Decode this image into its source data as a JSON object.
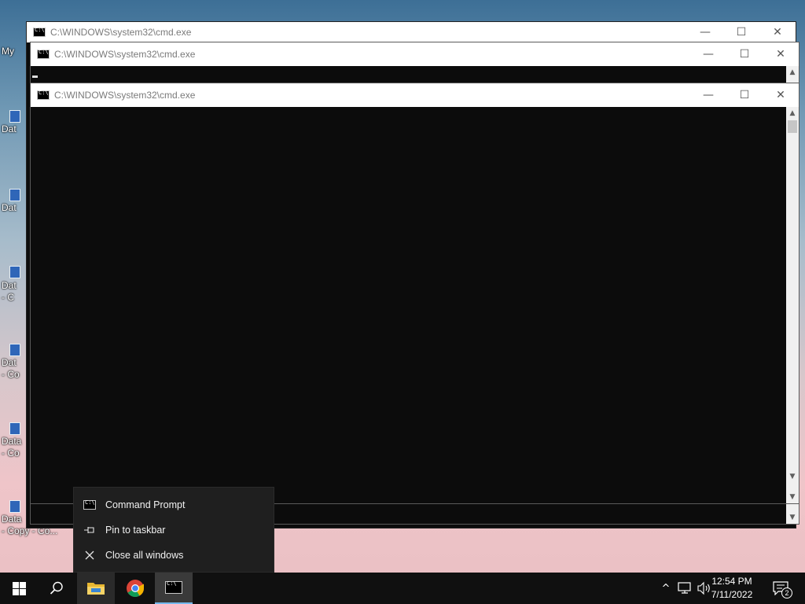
{
  "desktop": {
    "icons": [
      {
        "label": "My"
      },
      {
        "label": "Dat"
      },
      {
        "label": "Dat"
      },
      {
        "label": "Dat",
        "label2": "- C"
      },
      {
        "label": "Dat",
        "label2": "- Co"
      },
      {
        "label": "Data",
        "label2": "- Co"
      },
      {
        "label": "Data",
        "label2": "- Copy - Co..."
      }
    ]
  },
  "windows": [
    {
      "title": "C:\\WINDOWS\\system32\\cmd.exe"
    },
    {
      "title": "C:\\WINDOWS\\system32\\cmd.exe"
    },
    {
      "title": "C:\\WINDOWS\\system32\\cmd.exe"
    }
  ],
  "window_controls": {
    "minimize": "—",
    "maximize": "☐",
    "close": "✕"
  },
  "jumplist": {
    "items": [
      {
        "label": "Command Prompt",
        "icon": "cmd-icon"
      },
      {
        "label": "Pin to taskbar",
        "icon": "pin-icon"
      },
      {
        "label": "Close all windows",
        "icon": "close-icon"
      }
    ]
  },
  "taskbar": {
    "apps": [
      "start-icon",
      "search-icon",
      "file-explorer-icon",
      "chrome-icon",
      "cmd-icon"
    ],
    "clock": {
      "time": "12:54 PM",
      "date": "7/11/2022"
    },
    "notifications_count": "2"
  },
  "colors": {
    "accent": "#76b9ed",
    "console_bg": "#0c0c0c",
    "taskbar": "#101010",
    "menu_bg": "#1f1f1f"
  }
}
